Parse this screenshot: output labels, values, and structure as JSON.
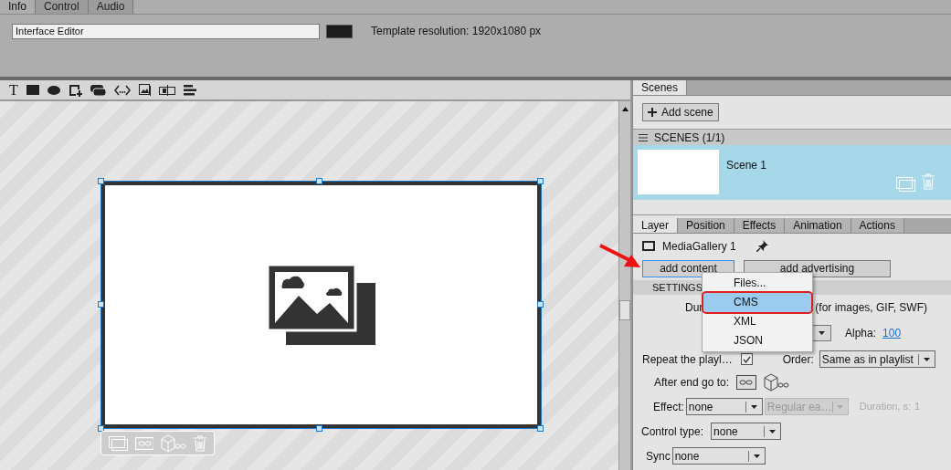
{
  "top_tabs": [
    {
      "label": "Info",
      "selected": true
    },
    {
      "label": "Control",
      "selected": false
    },
    {
      "label": "Audio",
      "selected": false
    }
  ],
  "text_tool": "T",
  "project_name": "Interface Editor",
  "resolution": "Template resolution: 1920x1080 px",
  "scenes_tab": "Scenes",
  "add_scene": "Add scene",
  "scenes_header": "SCENES (1/1)",
  "scenes": [
    {
      "name": "Scene 1",
      "selected": true
    }
  ],
  "layer_tabs": [
    {
      "label": "Layer",
      "selected": true
    },
    {
      "label": "Position",
      "selected": false
    },
    {
      "label": "Effects",
      "selected": false
    },
    {
      "label": "Animation",
      "selected": false
    },
    {
      "label": "Actions",
      "selected": false
    }
  ],
  "layer_name": "MediaGallery 1",
  "buttons": [
    "add content",
    "add advertising"
  ],
  "settings_header": "SETTINGS",
  "duration_label": "Dur",
  "duration_note": "(for images, GIF, SWF)",
  "alpha": {
    "label": "Alpha:",
    "value": "100"
  },
  "repeat": {
    "label": "Repeat the playl…",
    "checked": true
  },
  "order": {
    "label": "Order:",
    "value": "Same as in playlist"
  },
  "after_end": "After end go to:",
  "effect": {
    "label": "Effect:",
    "value": "none",
    "easing": "Regular ea…",
    "easing_disabled": true,
    "duration_label": "Duration, s:",
    "duration_value": "1"
  },
  "control_type": {
    "label": "Control type:",
    "value": "none"
  },
  "sync": {
    "label": "Sync",
    "value": "none"
  },
  "menu": [
    {
      "label": "Files...",
      "selected": false
    },
    {
      "label": "CMS",
      "selected": true
    },
    {
      "label": "XML",
      "selected": false
    },
    {
      "label": "JSON",
      "selected": false
    }
  ]
}
